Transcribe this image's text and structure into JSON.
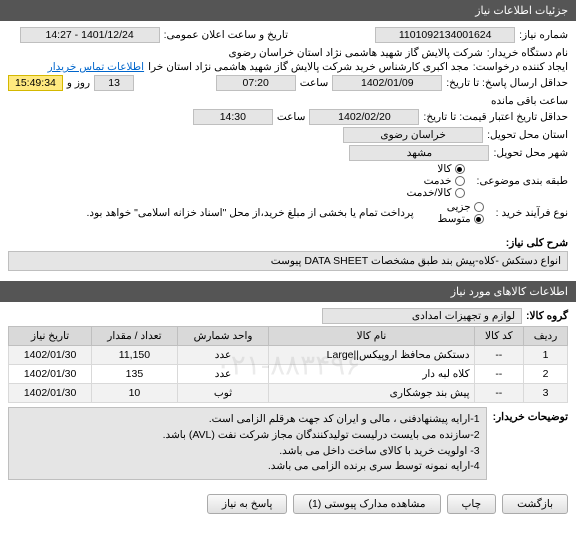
{
  "sections": {
    "need_details": "جزئیات اطلاعات نیاز",
    "need_items_info": "اطلاعات کالاهای مورد نیاز"
  },
  "labels": {
    "need_number": "شماره نیاز:",
    "announce_datetime": "تاریخ و ساعت اعلان عمومی:",
    "buyer_org": "نام دستگاه خریدار:",
    "request_creator": "ایجاد کننده درخواست:",
    "contact_info": "اطلاعات تماس خریدار",
    "deadline": "حداقل ارسال پاسخ: تا تاریخ:",
    "hour": "ساعت",
    "day_and": "روز و",
    "remaining": "ساعت باقی مانده",
    "price_validity": "حداقل تاریخ اعتبار قیمت: تا تاریخ:",
    "delivery_province": "استان محل تحویل:",
    "delivery_city": "شهر محل تحویل:",
    "subject_category": "طبقه بندی موضوعی:",
    "purchase_process": "نوع فرآیند خرید :",
    "need_title": "شرح کلی نیاز:",
    "goods_group": "گروه کالا:",
    "buyer_notes": "توضیحات خریدار:"
  },
  "values": {
    "need_number": "1101092134001624",
    "announce_datetime": "1401/12/24 - 14:27",
    "buyer_org": "شرکت پالایش گاز شهید هاشمی نژاد   استان خراسان رضوی",
    "request_creator": "مجد اکبری کارشناس خرید شرکت پالایش گاز شهید هاشمی نژاد   استان خرا",
    "deadline_date": "1402/01/09",
    "deadline_time": "07:20",
    "days_remain": "13",
    "time_remain": "15:49:34",
    "price_validity_date": "1402/02/20",
    "price_validity_time": "14:30",
    "province": "خراسان رضوی",
    "city": "مشهد",
    "need_title": "انواع دستکش -کلاه-پیش بند طبق مشخصات DATA SHEET پیوست",
    "goods_group": "لوازم و تجهیزات امدادی"
  },
  "subject_options": [
    {
      "label": "کالا",
      "selected": true
    },
    {
      "label": "خدمت",
      "selected": false
    },
    {
      "label": "کالا/خدمت",
      "selected": false
    }
  ],
  "process_options": [
    {
      "label": "جزیی",
      "selected": false
    },
    {
      "label": "متوسط",
      "selected": true
    }
  ],
  "process_note": "پرداخت تمام یا بخشی از مبلغ خرید،از محل \"اسناد خزانه اسلامی\" خواهد بود.",
  "table": {
    "headers": [
      "ردیف",
      "کد کالا",
      "نام کالا",
      "واحد شمارش",
      "تعداد / مقدار",
      "تاریخ نیاز"
    ],
    "rows": [
      {
        "n": "1",
        "code": "--",
        "name": "دستکش محافظ اروپیکس||Large",
        "unit": "عدد",
        "qty": "11,150",
        "date": "1402/01/30"
      },
      {
        "n": "2",
        "code": "--",
        "name": "کلاه لبه دار",
        "unit": "عدد",
        "qty": "135",
        "date": "1402/01/30"
      },
      {
        "n": "3",
        "code": "--",
        "name": "پیش بند جوشکاری",
        "unit": "ثوب",
        "qty": "10",
        "date": "1402/01/30"
      }
    ]
  },
  "buyer_notes": [
    "1-ارایه پیشنهادفنی ، مالی و ایران کد جهت هرقلم الزامی است.",
    "2-سازنده می بایست درلیست تولیدکنندگان مجاز شرکت نفت (AVL)  باشد.",
    "3- اولویت خرید  با کالای ساخت  داخل می باشد.",
    "4-ارایه نمونه توسط سری برنده الزامی می باشد."
  ],
  "watermark": "۰۲۱-۸۸۳۴۹۶",
  "buttons": {
    "back": "بازگشت",
    "print": "چاپ",
    "attachments": "مشاهده مدارک پیوستی  (1)",
    "respond": "پاسخ به نیاز"
  }
}
